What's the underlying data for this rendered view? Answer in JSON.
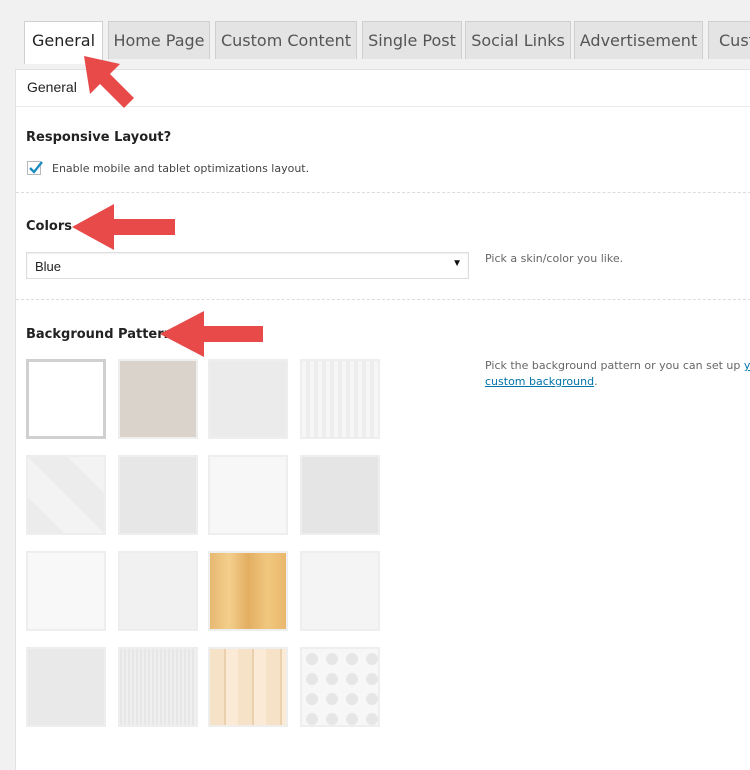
{
  "tabs": [
    {
      "label": "General",
      "active": true
    },
    {
      "label": "Home Page"
    },
    {
      "label": "Custom Content"
    },
    {
      "label": "Single Post"
    },
    {
      "label": "Social Links"
    },
    {
      "label": "Advertisement"
    },
    {
      "label": "Cust"
    }
  ],
  "panel": {
    "title": "General"
  },
  "responsive": {
    "label": "Responsive Layout?",
    "checkbox_label": "Enable mobile and tablet optimizations layout.",
    "checked": true
  },
  "colors": {
    "label": "Colors",
    "selected": "Blue",
    "help": "Pick a skin/color you like."
  },
  "background": {
    "label": "Background Pattern",
    "help_text": "Pick the background pattern or you can set up",
    "help_link_prefix": "yo",
    "help_link": "custom background",
    "help_suffix": ".",
    "patterns": [
      "white",
      "beige-linen",
      "light-gray",
      "vertical-stripes",
      "diagonal-x",
      "noise-gray",
      "speckle-white",
      "fine-gray",
      "soft-white",
      "plain-light",
      "wood-golden",
      "subtle-dots",
      "concrete",
      "crosshatch",
      "wood-planks",
      "circles-lace"
    ],
    "selected_index": 0
  },
  "colors_ui": {
    "arrow": "#e84a4a",
    "check": "#1e8cbe",
    "link": "#0073aa"
  }
}
